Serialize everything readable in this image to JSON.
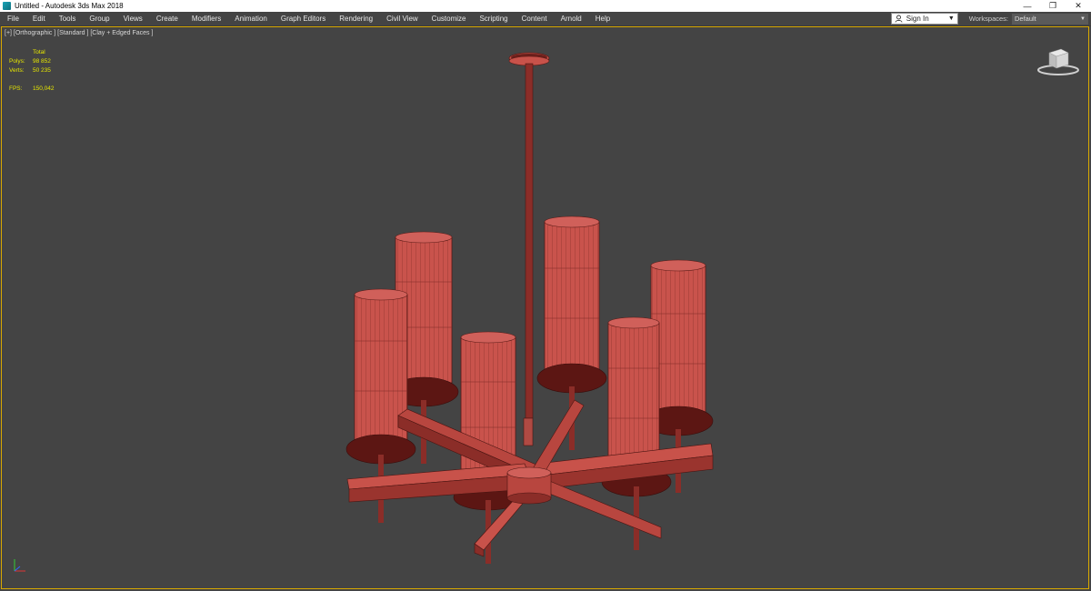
{
  "window": {
    "title": "Untitled - Autodesk 3ds Max 2018",
    "controls": [
      "minimize-icon",
      "restore-icon",
      "close-icon"
    ]
  },
  "menu": {
    "items": [
      "File",
      "Edit",
      "Tools",
      "Group",
      "Views",
      "Create",
      "Modifiers",
      "Animation",
      "Graph Editors",
      "Rendering",
      "Civil View",
      "Customize",
      "Scripting",
      "Content",
      "Arnold",
      "Help"
    ]
  },
  "account": {
    "signin_label": "Sign In"
  },
  "workspaces": {
    "label": "Workspaces:",
    "value": "Default"
  },
  "viewport": {
    "label": "[+] [Orthographic ] [Standard ] [Clay + Edged Faces ]",
    "stats": {
      "header": "Total",
      "polys_label": "Polys:",
      "polys_value": "98 852",
      "verts_label": "Verts:",
      "verts_value": "50 235",
      "fps_label": "FPS:",
      "fps_value": "150,042"
    },
    "model_color": "#c8524a",
    "selection_border": "#d8a800"
  },
  "colors": {
    "titlebar_bg": "#ffffff",
    "ui_bg": "#444444",
    "stats_text": "#e6e600"
  }
}
